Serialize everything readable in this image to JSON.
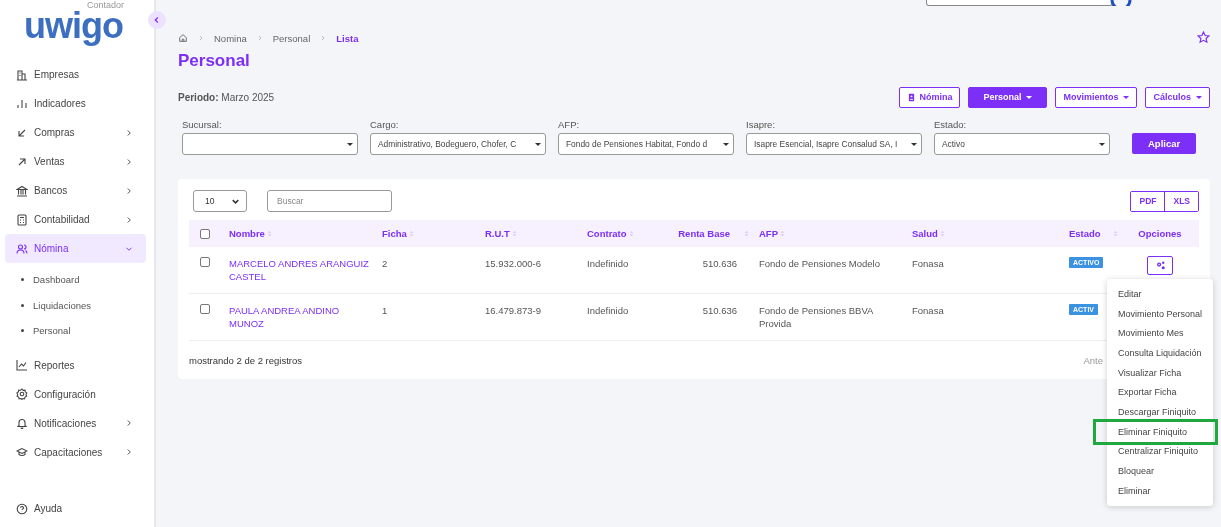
{
  "sidebar": {
    "logo": "uwigo",
    "logo_caption": "Contador",
    "items": [
      {
        "label": "Empresas",
        "selected": false
      },
      {
        "label": "Indicadores",
        "selected": false
      },
      {
        "label": "Compras",
        "selected": false,
        "expanded": false
      },
      {
        "label": "Ventas",
        "selected": false,
        "expanded": false
      },
      {
        "label": "Bancos",
        "selected": false,
        "expanded": false
      },
      {
        "label": "Contabilidad",
        "selected": false,
        "expanded": false
      },
      {
        "label": "Nómina",
        "selected": true,
        "expanded": true,
        "children": [
          {
            "label": "Dashboard"
          },
          {
            "label": "Liquidaciones"
          },
          {
            "label": "Personal"
          }
        ]
      },
      {
        "label": "Reportes",
        "selected": false
      },
      {
        "label": "Configuración",
        "selected": false
      },
      {
        "label": "Notificaciones",
        "selected": false,
        "expanded": false
      },
      {
        "label": "Capacitaciones",
        "selected": false,
        "expanded": false
      }
    ],
    "footer_item": "Ayuda"
  },
  "breadcrumb": [
    {
      "label": "Nomina",
      "selected": false
    },
    {
      "label": "Personal",
      "selected": false
    },
    {
      "label": "Lista",
      "selected": true
    }
  ],
  "title": "Personal",
  "period": {
    "label": "Periodo:",
    "value": "Marzo 2025"
  },
  "header_buttons": [
    {
      "label": "Nómina",
      "kind": "icon"
    },
    {
      "label": "Personal",
      "kind": "primary"
    },
    {
      "label": "Movimientos",
      "kind": "dropdown"
    },
    {
      "label": "Cálculos",
      "kind": "dropdown"
    }
  ],
  "filters": [
    {
      "label": "Sucursal:"
    },
    {
      "label": "Cargo:",
      "value": "Administrativo, Bodeguero, Chofer, C"
    },
    {
      "label": "AFP:",
      "value": "Fondo de Pensiones Habitat, Fondo d"
    },
    {
      "label": "Isapre:",
      "value": "Isapre Esencial, Isapre Consalud SA, I"
    },
    {
      "label": "Estado:",
      "value": "Activo"
    }
  ],
  "apply_button": "Aplicar",
  "table": {
    "page_size": "10",
    "search_placeholder": "Buscar",
    "export_buttons": [
      "PDF",
      "XLS"
    ],
    "columns": [
      "Nombre",
      "Ficha",
      "R.U.T",
      "Contrato",
      "Renta Base",
      "AFP",
      "Salud",
      "Estado",
      "Opciones"
    ],
    "header_checked": false,
    "rows": [
      {
        "checked": false,
        "nombre": "MARCELO ANDRES ARANGUIZ CASTEL",
        "ficha": "2",
        "rut": "15.932.000-6",
        "contrato": "Indefinido",
        "renta": "510.636",
        "afp": "Fondo de Pensiones Modelo",
        "salud": "Fonasa",
        "estado": "ACTIVO",
        "options_button": true
      },
      {
        "checked": false,
        "nombre": "PAULA ANDREA ANDINO MUNOZ",
        "ficha": "1",
        "rut": "16.479.873-9",
        "contrato": "Indefinido",
        "renta": "510.636",
        "afp": "Fondo de Pensiones BBVA Provida",
        "salud": "Fonasa",
        "estado": "ACTIV",
        "options_button": false
      }
    ],
    "footer": "mostrando 2 de 2 registros",
    "pager": "Ante"
  },
  "menu": {
    "items": [
      {
        "label": "Editar",
        "highlighted": false
      },
      {
        "label": "Movimiento Personal",
        "highlighted": false
      },
      {
        "label": "Movimiento Mes",
        "highlighted": false
      },
      {
        "label": "Consulta Liquidación",
        "highlighted": false
      },
      {
        "label": "Visualizar Ficha",
        "highlighted": false
      },
      {
        "label": "Exportar Ficha",
        "highlighted": false
      },
      {
        "label": "Descargar Finiquito",
        "highlighted": false
      },
      {
        "label": "Eliminar Finiquito",
        "highlighted": true
      },
      {
        "label": "Centralizar Finiquito",
        "highlighted": false
      },
      {
        "label": "Bloquear",
        "highlighted": false
      },
      {
        "label": "Eliminar",
        "highlighted": false
      }
    ]
  }
}
